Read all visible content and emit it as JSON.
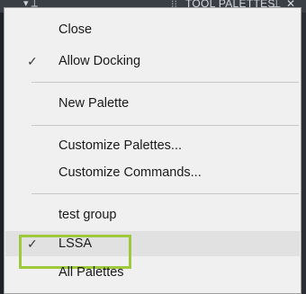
{
  "titlebar": {
    "grip_icon": "grip-icon",
    "title": "TOOL PALETTES",
    "dropdown_glyph": "◂",
    "close_glyph": "✕",
    "pin_glyph": "⊥"
  },
  "menu": {
    "items": [
      {
        "label": "Close",
        "checked": false
      },
      {
        "label": "Allow Docking",
        "checked": true
      },
      {
        "label": "New Palette",
        "checked": false
      },
      {
        "label": "Customize Palettes...",
        "checked": false
      },
      {
        "label": "Customize Commands...",
        "checked": false
      },
      {
        "label": "test group",
        "checked": false
      },
      {
        "label": "LSSA",
        "checked": true
      },
      {
        "label": "All Palettes",
        "checked": false
      }
    ],
    "check_glyph": "✓",
    "highlight_color": "#9ec93a"
  }
}
